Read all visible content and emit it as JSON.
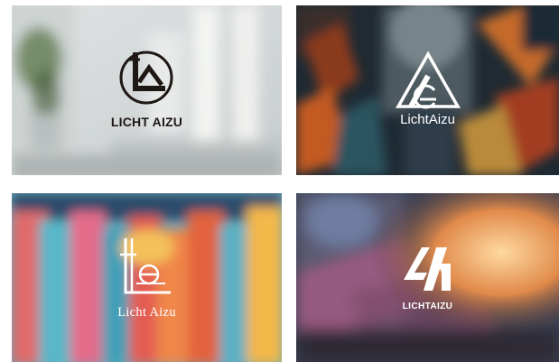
{
  "tiles": [
    {
      "wordmark": "LICHT AIZU",
      "background": "blurred-white-office-interior",
      "text_color": "#1e1714"
    },
    {
      "wordmark": "LichtAizu",
      "background": "blurred-dark-mosaic-figure",
      "text_color": "#ffffff"
    },
    {
      "wordmark": "Licht Aizu",
      "background": "blurred-colorful-raised-fists",
      "text_color": "#ffffff"
    },
    {
      "wordmark": "LICHTAIZU",
      "background": "blurred-glowing-lightbulb",
      "text_color": "#ffffff"
    }
  ]
}
